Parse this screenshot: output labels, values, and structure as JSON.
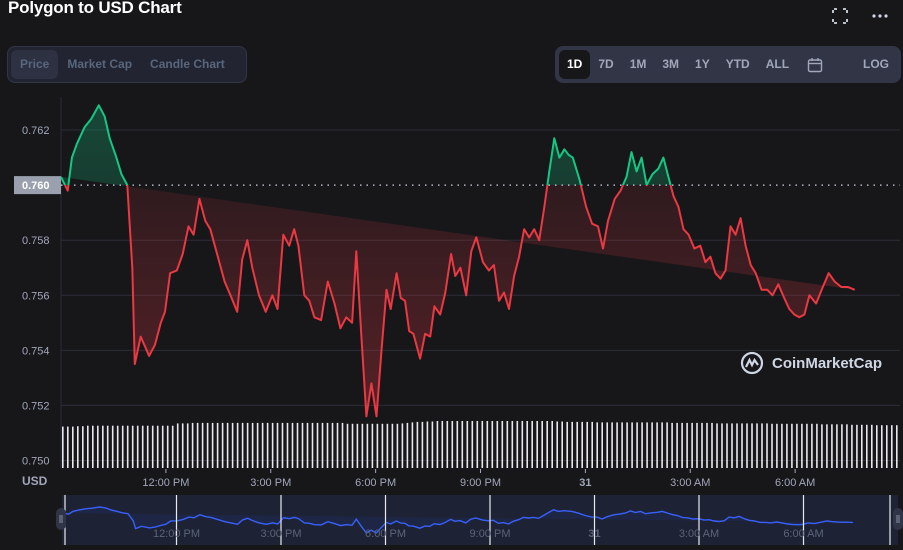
{
  "header": {
    "title": "Polygon to USD Chart",
    "fullscreen_icon": "fullscreen-icon",
    "more_icon": "more-horizontal-icon"
  },
  "chart_tabs": [
    {
      "label": "Price",
      "active": true
    },
    {
      "label": "Market Cap",
      "active": false
    },
    {
      "label": "Candle Chart",
      "active": false
    }
  ],
  "range_tabs": [
    {
      "label": "1D",
      "active": true
    },
    {
      "label": "7D",
      "active": false
    },
    {
      "label": "1M",
      "active": false
    },
    {
      "label": "3M",
      "active": false
    },
    {
      "label": "1Y",
      "active": false
    },
    {
      "label": "YTD",
      "active": false
    },
    {
      "label": "ALL",
      "active": false
    }
  ],
  "calendar_icon": "calendar-icon",
  "log_label": "LOG",
  "watermark": "CoinMarketCap",
  "currency_label": "USD",
  "colors": {
    "up": "#16c784",
    "down": "#ea3943",
    "navigator_line": "#3861fb",
    "background": "#17171a"
  },
  "chart_data": {
    "type": "line",
    "title": "Polygon to USD Chart",
    "xlabel": "",
    "ylabel": "USD",
    "ylim": [
      0.7498,
      0.7632
    ],
    "yticks": [
      "0.750",
      "0.752",
      "0.754",
      "0.756",
      "0.758",
      "0.760",
      "0.762"
    ],
    "reference_price": 0.76,
    "reference_label": "0.760",
    "grid": true,
    "legend": "none",
    "xticks": [
      {
        "label": "12:00 PM",
        "pos": 0.125,
        "bold": false
      },
      {
        "label": "3:00 PM",
        "pos": 0.25,
        "bold": false
      },
      {
        "label": "6:00 PM",
        "pos": 0.375,
        "bold": false
      },
      {
        "label": "9:00 PM",
        "pos": 0.5,
        "bold": false
      },
      {
        "label": "31",
        "pos": 0.625,
        "bold": true
      },
      {
        "label": "3:00 AM",
        "pos": 0.75,
        "bold": false
      },
      {
        "label": "6:00 AM",
        "pos": 0.875,
        "bold": false
      }
    ],
    "x_range_hours": [
      9.0,
      33.0
    ],
    "series": [
      {
        "name": "Price",
        "x": [
          0,
          0.008,
          0.013,
          0.019,
          0.028,
          0.036,
          0.045,
          0.052,
          0.058,
          0.066,
          0.072,
          0.079,
          0.085,
          0.088,
          0.095,
          0.105,
          0.112,
          0.119,
          0.124,
          0.13,
          0.138,
          0.145,
          0.152,
          0.158,
          0.165,
          0.172,
          0.178,
          0.186,
          0.195,
          0.202,
          0.21,
          0.216,
          0.222,
          0.228,
          0.236,
          0.244,
          0.252,
          0.258,
          0.265,
          0.272,
          0.278,
          0.283,
          0.29,
          0.296,
          0.302,
          0.31,
          0.318,
          0.326,
          0.333,
          0.34,
          0.347,
          0.352,
          0.358,
          0.364,
          0.37,
          0.376,
          0.382,
          0.388,
          0.393,
          0.4,
          0.405,
          0.41,
          0.415,
          0.42,
          0.428,
          0.434,
          0.44,
          0.445,
          0.452,
          0.458,
          0.465,
          0.47,
          0.476,
          0.483,
          0.489,
          0.495,
          0.503,
          0.51,
          0.516,
          0.522,
          0.528,
          0.534,
          0.54,
          0.546,
          0.552,
          0.558,
          0.564,
          0.57,
          0.576,
          0.582,
          0.588,
          0.594,
          0.6,
          0.605,
          0.61,
          0.618,
          0.626,
          0.633,
          0.64,
          0.646,
          0.652,
          0.66,
          0.667,
          0.674,
          0.68,
          0.686,
          0.692,
          0.698,
          0.705,
          0.712,
          0.718,
          0.724,
          0.73,
          0.736,
          0.742,
          0.748,
          0.755,
          0.762,
          0.768,
          0.774,
          0.78,
          0.786,
          0.792,
          0.798,
          0.804,
          0.81,
          0.816,
          0.822,
          0.828,
          0.835,
          0.842,
          0.848,
          0.855,
          0.862,
          0.868,
          0.874,
          0.88,
          0.886,
          0.892,
          0.9,
          0.908,
          0.915,
          0.922,
          0.93,
          0.938,
          0.946,
          0.952,
          0.958,
          0.964,
          0.97,
          0.976,
          0.982,
          0.988,
          1.0
        ],
        "values": [
          0.7603,
          0.7598,
          0.761,
          0.7615,
          0.7621,
          0.7624,
          0.7629,
          0.7625,
          0.7617,
          0.761,
          0.7604,
          0.76,
          0.757,
          0.7535,
          0.7545,
          0.7538,
          0.7542,
          0.755,
          0.7554,
          0.7568,
          0.7569,
          0.7575,
          0.7585,
          0.7582,
          0.7595,
          0.7587,
          0.7584,
          0.7575,
          0.7565,
          0.756,
          0.7554,
          0.7573,
          0.758,
          0.757,
          0.756,
          0.7554,
          0.756,
          0.7555,
          0.7582,
          0.7578,
          0.7584,
          0.7578,
          0.756,
          0.7558,
          0.7552,
          0.7551,
          0.7565,
          0.7557,
          0.7548,
          0.7552,
          0.755,
          0.7576,
          0.7545,
          0.7516,
          0.7528,
          0.7516,
          0.754,
          0.7562,
          0.7555,
          0.7568,
          0.7559,
          0.7558,
          0.7547,
          0.7546,
          0.7537,
          0.7546,
          0.7545,
          0.7556,
          0.7553,
          0.7561,
          0.7575,
          0.7567,
          0.757,
          0.756,
          0.7576,
          0.7581,
          0.7572,
          0.7569,
          0.7571,
          0.7558,
          0.7561,
          0.7555,
          0.7567,
          0.7574,
          0.7584,
          0.7581,
          0.7584,
          0.758,
          0.7592,
          0.7605,
          0.7617,
          0.761,
          0.7613,
          0.7611,
          0.761,
          0.7602,
          0.7592,
          0.7586,
          0.7585,
          0.7577,
          0.7587,
          0.7595,
          0.7598,
          0.7603,
          0.7612,
          0.7605,
          0.761,
          0.76,
          0.7604,
          0.7606,
          0.761,
          0.7603,
          0.7596,
          0.7592,
          0.7584,
          0.7582,
          0.7577,
          0.7578,
          0.7572,
          0.7574,
          0.7568,
          0.7566,
          0.7569,
          0.7585,
          0.7582,
          0.7588,
          0.7578,
          0.7571,
          0.7568,
          0.7562,
          0.7562,
          0.756,
          0.7564,
          0.7559,
          0.7555,
          0.7553,
          0.7552,
          0.7553,
          0.756,
          0.7557,
          0.7563,
          0.7568,
          0.7565,
          0.7563,
          0.7563,
          0.7562
        ]
      }
    ],
    "volume_bars": {
      "count": 168,
      "relative_heights": [
        0.88,
        0.88,
        0.88,
        0.89,
        0.89,
        0.9,
        0.9,
        0.9,
        0.9,
        0.9,
        0.9,
        0.9,
        0.9,
        0.9,
        0.9,
        0.9,
        0.9,
        0.9,
        0.9,
        0.9,
        0.9,
        0.9,
        0.9,
        0.95,
        0.95,
        0.95,
        0.96,
        0.96,
        0.96,
        0.96,
        0.96,
        0.96,
        0.96,
        0.96,
        0.96,
        0.96,
        0.96,
        0.96,
        0.96,
        0.96,
        0.96,
        0.96,
        0.96,
        0.96,
        0.96,
        0.96,
        0.96,
        0.96,
        0.96,
        0.96,
        0.96,
        0.96,
        0.96,
        0.96,
        0.96,
        0.96,
        0.96,
        0.94,
        0.94,
        0.94,
        0.94,
        0.94,
        0.94,
        0.94,
        0.94,
        0.94,
        0.94,
        0.94,
        0.95,
        0.96,
        0.97,
        0.98,
        0.98,
        0.99,
        0.99,
        1.0,
        1.0,
        1.0,
        1.0,
        1.0,
        1.0,
        1.0,
        1.0,
        1.0,
        1.0,
        1.0,
        1.0,
        1.0,
        1.0,
        1.0,
        1.0,
        1.0,
        1.0,
        1.0,
        1.0,
        1.0,
        1.0,
        1.0,
        1.0,
        0.99,
        0.99,
        0.98,
        0.98,
        0.98,
        0.98,
        0.98,
        0.98,
        0.97,
        0.97,
        0.97,
        0.97,
        0.97,
        0.97,
        0.97,
        0.97,
        0.97,
        0.97,
        0.97,
        0.97,
        0.97,
        0.97,
        0.97,
        0.96,
        0.96,
        0.96,
        0.96,
        0.96,
        0.96,
        0.96,
        0.96,
        0.96,
        0.95,
        0.95,
        0.95,
        0.95,
        0.95,
        0.95,
        0.95,
        0.95,
        0.95,
        0.95,
        0.95,
        0.94,
        0.94,
        0.94,
        0.94,
        0.94,
        0.94,
        0.94,
        0.94,
        0.94,
        0.94,
        0.93,
        0.93,
        0.93,
        0.93,
        0.93,
        0.93,
        0.92,
        0.92,
        0.92,
        0.92,
        0.92,
        0.91,
        0.91,
        0.91,
        0.91,
        0.91
      ]
    }
  }
}
